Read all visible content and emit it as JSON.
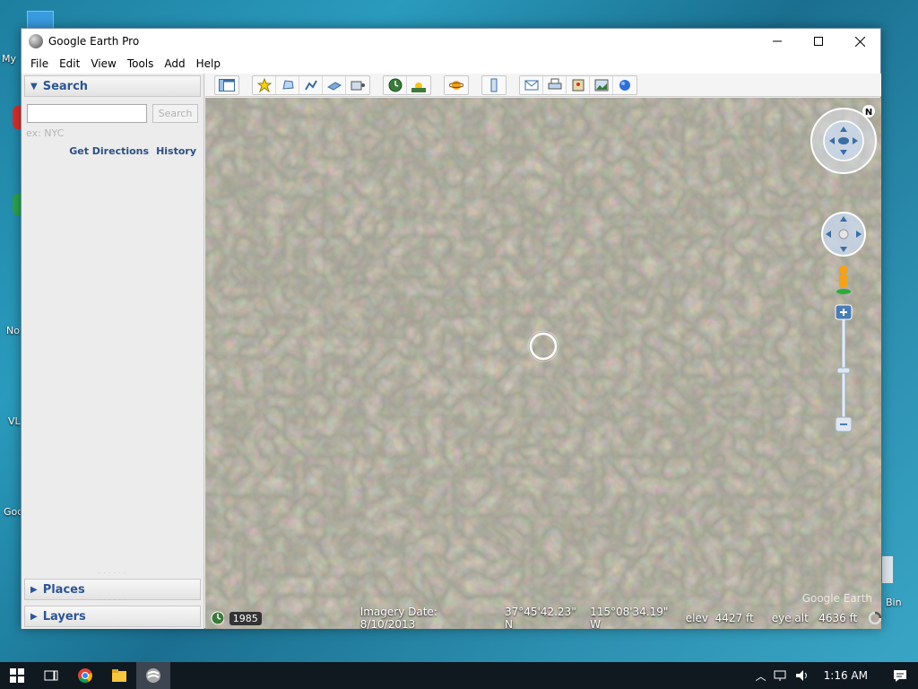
{
  "window": {
    "title": "Google Earth Pro"
  },
  "menu": [
    "File",
    "Edit",
    "View",
    "Tools",
    "Add",
    "Help"
  ],
  "search": {
    "header": "Search",
    "placeholder": "",
    "button": "Search",
    "hint": "ex: NYC",
    "get_directions": "Get Directions",
    "history": "History"
  },
  "places": {
    "label": "Places"
  },
  "layers": {
    "label": "Layers"
  },
  "status": {
    "year": "1985",
    "imagery_date": "Imagery Date: 8/10/2013",
    "lat": "37°45'42.23\" N",
    "lon": "115°08'34.19\" W",
    "elev": "elev  4427 ft",
    "eye_alt": "eye alt   4636 ft"
  },
  "watermark": "Google Earth",
  "desktop": {
    "labels": [
      "My",
      "No",
      "VL",
      "Goo",
      "Bin"
    ]
  },
  "taskbar": {
    "time": "1:16 AM"
  },
  "colors": {
    "accent": "#2d5590",
    "link": "#2d4f84"
  }
}
